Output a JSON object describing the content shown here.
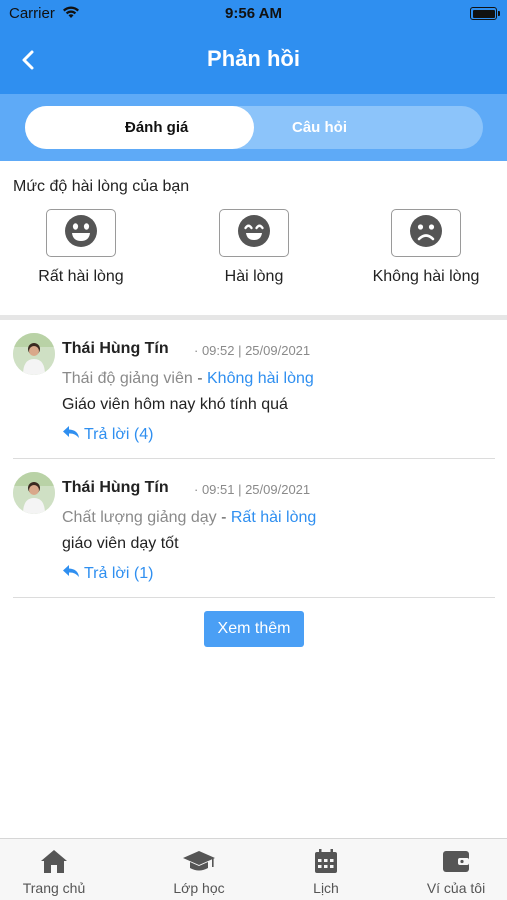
{
  "status_bar": {
    "carrier": "Carrier",
    "time": "9:56 AM"
  },
  "header": {
    "title": "Phản hồi",
    "back_icon": "chevron-left-icon"
  },
  "segments": {
    "active": "Đánh giá",
    "inactive": "Câu hỏi"
  },
  "satisfaction": {
    "label": "Mức độ hài lòng của bạn",
    "levels": [
      {
        "label": "Rất hài lòng",
        "icon": "grin-icon"
      },
      {
        "label": "Hài lòng",
        "icon": "smile-icon"
      },
      {
        "label": "Không hài lòng",
        "icon": "frown-icon"
      }
    ]
  },
  "posts": [
    {
      "name": "Thái Hùng Tín",
      "meta": "· 09:52 | 25/09/2021",
      "category": "Thái độ giảng viên",
      "separator": "-",
      "rating": "Không hài lòng",
      "content": "Giáo viên hôm nay khó tính quá",
      "reply": "Trả lời (4)"
    },
    {
      "name": "Thái Hùng Tín",
      "meta": "· 09:51 | 25/09/2021",
      "category": "Chất lượng giảng dạy",
      "separator": "-",
      "rating": "Rất hài lòng",
      "content": "giáo viên dạy tốt",
      "reply": "Trả lời (1)"
    }
  ],
  "more_button": "Xem thêm",
  "tabbar": [
    {
      "label": "Trang chủ",
      "icon": "home-icon"
    },
    {
      "label": "Lớp học",
      "icon": "graduation-cap-icon"
    },
    {
      "label": "Lịch",
      "icon": "calendar-icon"
    },
    {
      "label": "Ví của tôi",
      "icon": "wallet-icon"
    }
  ],
  "colors": {
    "primary": "#2f8ff0",
    "segment_bg": "#5eaaf7",
    "muted": "#8a8a8a"
  }
}
